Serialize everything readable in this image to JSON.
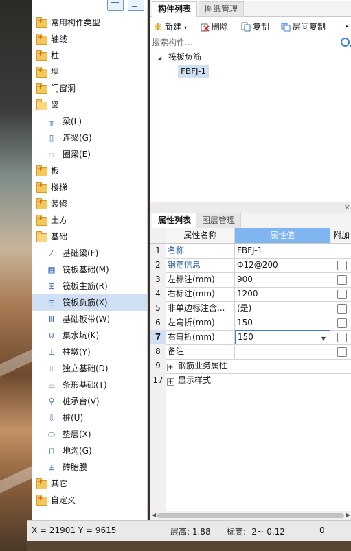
{
  "tree": {
    "items": [
      {
        "label": "常用构件类型",
        "kind": "folder"
      },
      {
        "label": "轴线",
        "kind": "folder"
      },
      {
        "label": "柱",
        "kind": "folder"
      },
      {
        "label": "墙",
        "kind": "folder"
      },
      {
        "label": "门窗洞",
        "kind": "folder"
      },
      {
        "label": "梁",
        "kind": "folder-open"
      },
      {
        "label": "梁(L)",
        "kind": "child",
        "icon": "beam-icon"
      },
      {
        "label": "连梁(G)",
        "kind": "child",
        "icon": "coupling-beam-icon"
      },
      {
        "label": "圈梁(E)",
        "kind": "child",
        "icon": "ring-beam-icon"
      },
      {
        "label": "板",
        "kind": "folder"
      },
      {
        "label": "楼梯",
        "kind": "folder"
      },
      {
        "label": "装修",
        "kind": "folder"
      },
      {
        "label": "土方",
        "kind": "folder"
      },
      {
        "label": "基础",
        "kind": "folder-open"
      },
      {
        "label": "基础梁(F)",
        "kind": "child",
        "icon": "foundation-beam-icon"
      },
      {
        "label": "筏板基础(M)",
        "kind": "child",
        "icon": "raft-foundation-icon"
      },
      {
        "label": "筏板主筋(R)",
        "kind": "child",
        "icon": "raft-main-rebar-icon"
      },
      {
        "label": "筏板负筋(X)",
        "kind": "child",
        "icon": "raft-negative-rebar-icon",
        "selected": true
      },
      {
        "label": "基础板带(W)",
        "kind": "child",
        "icon": "foundation-strip-icon"
      },
      {
        "label": "集水坑(K)",
        "kind": "child",
        "icon": "sump-pit-icon"
      },
      {
        "label": "柱墩(Y)",
        "kind": "child",
        "icon": "column-pier-icon"
      },
      {
        "label": "独立基础(D)",
        "kind": "child",
        "icon": "isolated-footing-icon"
      },
      {
        "label": "条形基础(T)",
        "kind": "child",
        "icon": "strip-footing-icon"
      },
      {
        "label": "桩承台(V)",
        "kind": "child",
        "icon": "pile-cap-icon"
      },
      {
        "label": "桩(U)",
        "kind": "child",
        "icon": "pile-icon"
      },
      {
        "label": "垫层(X)",
        "kind": "child",
        "icon": "cushion-icon"
      },
      {
        "label": "地沟(G)",
        "kind": "child",
        "icon": "trench-icon"
      },
      {
        "label": "砖胎膜",
        "kind": "child",
        "icon": "brick-mold-icon"
      },
      {
        "label": "其它",
        "kind": "folder"
      },
      {
        "label": "自定义",
        "kind": "folder"
      }
    ]
  },
  "component_panel": {
    "tabs": [
      "构件列表",
      "图纸管理"
    ],
    "toolbar": {
      "new": "新建",
      "delete": "删除",
      "copy": "复制",
      "layer_copy": "层间复制"
    },
    "search_placeholder": "搜索构件...",
    "group_label": "筏板负筋",
    "selected_item": "FBFJ-1"
  },
  "property_panel": {
    "tabs": [
      "属性列表",
      "图层管理"
    ],
    "headers": {
      "name": "属性名称",
      "value": "属性值",
      "extra": "附加"
    },
    "rows": [
      {
        "num": "1",
        "name": "名称",
        "value": "FBFJ-1",
        "blue": true,
        "check": false
      },
      {
        "num": "2",
        "name": "钢筋信息",
        "value": "Φ12@200",
        "blue": true,
        "check": true
      },
      {
        "num": "3",
        "name": "左标注(mm)",
        "value": "900",
        "blue": false,
        "check": true
      },
      {
        "num": "4",
        "name": "右标注(mm)",
        "value": "1200",
        "blue": false,
        "check": true
      },
      {
        "num": "5",
        "name": "非单边标注含...",
        "value": "(是)",
        "blue": false,
        "check": true
      },
      {
        "num": "6",
        "name": "左弯折(mm)",
        "value": "150",
        "blue": false,
        "check": true
      },
      {
        "num": "7",
        "name": "右弯折(mm)",
        "value": "150",
        "blue": false,
        "check": true,
        "editing": true
      },
      {
        "num": "8",
        "name": "备注",
        "value": "",
        "blue": false,
        "check": true
      },
      {
        "num": "9",
        "name": "钢筋业务属性",
        "value": "",
        "blue": false,
        "check": false,
        "group": true
      },
      {
        "num": "17",
        "name": "显示样式",
        "value": "",
        "blue": false,
        "check": false,
        "group": true
      }
    ]
  },
  "status_bar": {
    "coords": "X = 21901 Y = 9615",
    "floor_height": "层高:  1.88",
    "elevation": "标高: -2~-0.12",
    "zero": "0"
  },
  "colors": {
    "selection": "#cfe0f5",
    "accent": "#3d7dd6",
    "header_value": "#7fb5f0"
  }
}
